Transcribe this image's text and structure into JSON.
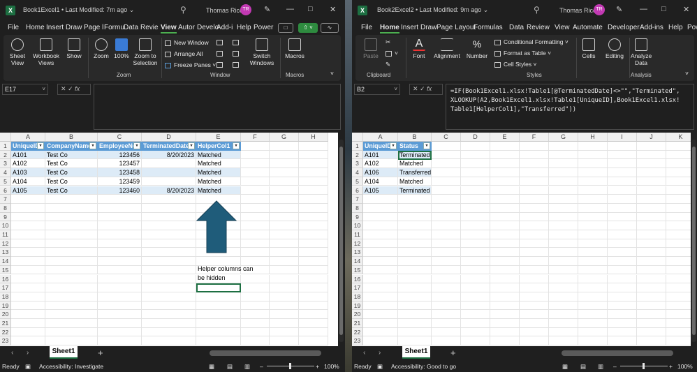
{
  "left": {
    "title": "Book1Excel1 • Last Modified: 7m ago ⌄",
    "user": "Thomas Rice",
    "initials": "TR",
    "tabs": [
      "File",
      "Home",
      "Insert",
      "Draw",
      "Page l",
      "Formu",
      "Data",
      "Revie",
      "View",
      "Autor",
      "Develo",
      "Add-i",
      "Help",
      "Power"
    ],
    "active_tab": "View",
    "ribbon": {
      "sheet_view": "Sheet\nView",
      "workbook_views": "Workbook\nViews",
      "show": "Show",
      "zoom": "Zoom",
      "zoom100": "100%",
      "zoom_to_selection": "Zoom to\nSelection",
      "new_window": "New Window",
      "arrange_all": "Arrange All",
      "freeze_panes": "Freeze Panes",
      "switch_windows": "Switch\nWindows",
      "macros": "Macros",
      "group_zoom": "Zoom",
      "group_window": "Window",
      "group_macros": "Macros"
    },
    "name_box": "E17",
    "formula": "",
    "columns": [
      "A",
      "B",
      "C",
      "D",
      "E",
      "F",
      "G",
      "H"
    ],
    "rows": [
      "1",
      "2",
      "3",
      "4",
      "5",
      "6",
      "7",
      "8",
      "9",
      "10",
      "11",
      "12",
      "13",
      "14",
      "15",
      "16",
      "17",
      "18",
      "19",
      "20",
      "21",
      "22",
      "23"
    ],
    "table_headers": [
      "UniqueID",
      "CompanyName",
      "EmployeeNo",
      "TerminatedDate",
      "HelperCol1"
    ],
    "table_rows": [
      [
        "A101",
        "Test Co",
        "123456",
        "8/20/2023",
        "Matched"
      ],
      [
        "A102",
        "Test Co",
        "123457",
        "",
        "Matched"
      ],
      [
        "A103",
        "Test Co",
        "123458",
        "",
        "Matched"
      ],
      [
        "A104",
        "Test Co",
        "123459",
        "",
        "Matched"
      ],
      [
        "A105",
        "Test Co",
        "123460",
        "8/20/2023",
        "Matched"
      ]
    ],
    "note_line1": "Helper columns can",
    "note_line2": "be hidden",
    "arrow_color": "#1f5c7a",
    "sheet_tab": "Sheet1",
    "status_ready": "Ready",
    "status_accessibility": "Accessibility: Investigate",
    "zoom_pct": "100%"
  },
  "right": {
    "title": "Book2Excel2 • Last Modified: 9m ago ⌄",
    "user": "Thomas Rice",
    "initials": "TR",
    "tabs": [
      "File",
      "Home",
      "Insert",
      "Draw",
      "Page Layout",
      "Formulas",
      "Data",
      "Review",
      "View",
      "Automate",
      "Developer",
      "Add-ins",
      "Help",
      "Pow"
    ],
    "active_tab": "Home",
    "ribbon": {
      "paste": "Paste",
      "font": "Font",
      "alignment": "Alignment",
      "number": "Number",
      "conditional_formatting": "Conditional Formatting",
      "format_as_table": "Format as Table",
      "cell_styles": "Cell Styles",
      "cells": "Cells",
      "editing": "Editing",
      "analyze_data": "Analyze\nData",
      "group_clipboard": "Clipboard",
      "group_styles": "Styles",
      "group_analysis": "Analysis"
    },
    "name_box": "B2",
    "formula": "=IF(Book1Excel1.xlsx!Table1[@TerminatedDate]<>\"\",\"Terminated\",\nXLOOKUP(A2,Book1Excel1.xlsx!Table1[UniqueID],Book1Excel1.xlsx!\nTable1[HelperCol1],\"Transferred\"))",
    "columns": [
      "A",
      "B",
      "C",
      "D",
      "E",
      "F",
      "G",
      "H",
      "I",
      "J",
      "K"
    ],
    "rows": [
      "1",
      "2",
      "3",
      "4",
      "5",
      "6",
      "7",
      "8",
      "9",
      "10",
      "11",
      "12",
      "13",
      "14",
      "15",
      "16",
      "17",
      "18",
      "19",
      "20",
      "21",
      "22",
      "23"
    ],
    "table_headers": [
      "UniqueID",
      "Status"
    ],
    "table_rows": [
      [
        "A101",
        "Terminated"
      ],
      [
        "A102",
        "Matched"
      ],
      [
        "A106",
        "Transferred"
      ],
      [
        "A104",
        "Matched"
      ],
      [
        "A105",
        "Terminated"
      ]
    ],
    "sheet_tab": "Sheet1",
    "status_ready": "Ready",
    "status_accessibility": "Accessibility: Good to go",
    "zoom_pct": "100%"
  }
}
